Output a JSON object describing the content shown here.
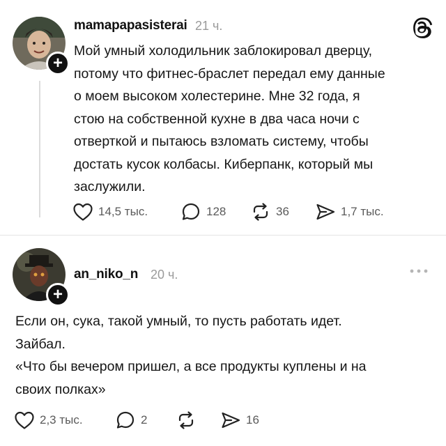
{
  "app": {
    "logo_icon": "threads-logo-icon",
    "accent": "#111111",
    "muted": "#9a9a9a"
  },
  "posts": [
    {
      "username": "mamapapasisterai",
      "time": "21 ч.",
      "avatar_icon": "profile-photo",
      "text_lines": [
        "Мой умный холодильник заблокировал дверцу,",
        "потому что фитнес-браслет передал ему данные",
        "о моем высоком холестерине. Мне 32 года, я",
        "стою на собственной кухне в два часа ночи с",
        "отверткой и пытаюсь взломать систему, чтобы",
        "достать кусок колбасы. Киберпанк, который мы",
        "заслужили."
      ],
      "likes": "14,5 тыс.",
      "replies": "128",
      "reposts": "36",
      "shares": "1,7 тыс."
    },
    {
      "username": "an_niko_n",
      "time": "20 ч.",
      "avatar_icon": "profile-photo",
      "text_lines": [
        "Если он, сука, такой умный, то пусть работать идет.",
        "Зайбал.",
        "«Что бы вечером пришел, а все продукты куплены и на",
        "своих полках»"
      ],
      "likes": "2,3 тыс.",
      "replies": "2",
      "reposts": "",
      "shares": "16"
    }
  ]
}
